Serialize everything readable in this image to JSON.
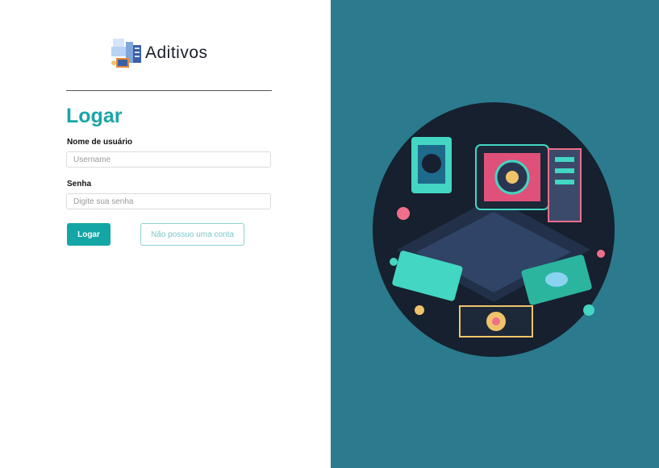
{
  "brand": {
    "name": "Aditivos",
    "logo_icon": "server-computer-icon"
  },
  "form": {
    "title": "Logar",
    "username_label": "Nome de usuário",
    "username_placeholder": "Username",
    "username_value": "",
    "password_label": "Senha",
    "password_placeholder": "Digite sua senha",
    "password_value": "",
    "login_button": "Logar",
    "no_account_button": "Não possuo uma conta"
  },
  "colors": {
    "accent": "#13a6a5",
    "right_panel": "#2b7a8e"
  },
  "illustration": {
    "icon": "tech-devices-illustration"
  }
}
